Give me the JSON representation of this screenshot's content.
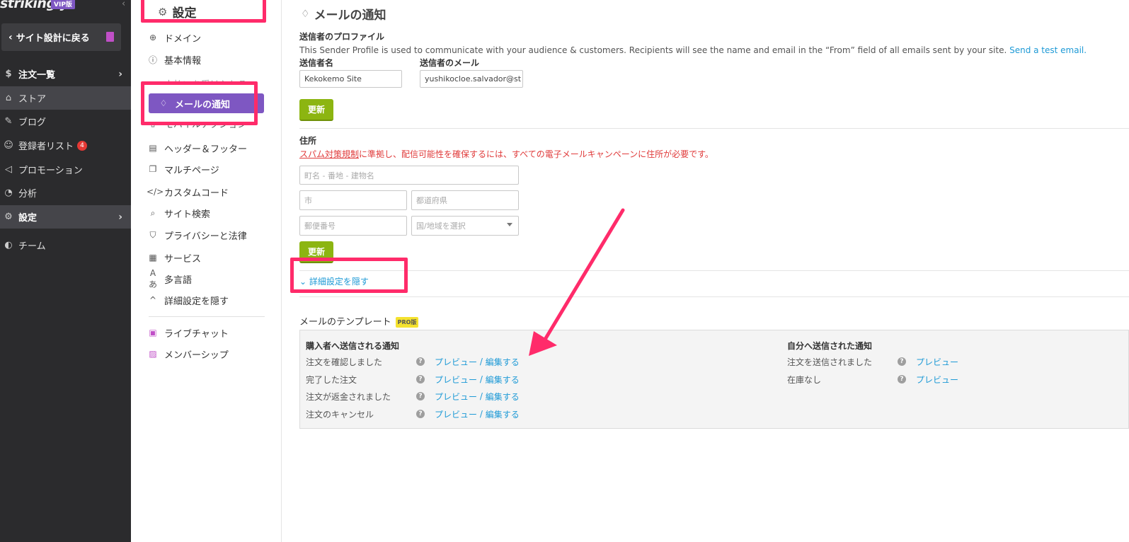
{
  "sidebar": {
    "logo": "strikingly",
    "plan_badge": "VIP版",
    "back_label": "サイト設計に戻る",
    "items": [
      {
        "label": "注文一覧",
        "icon": "dollar-circle-icon"
      },
      {
        "label": "ストア",
        "icon": "store-icon"
      },
      {
        "label": "ブログ",
        "icon": "pen-icon"
      },
      {
        "label": "登録者リスト",
        "icon": "users-icon",
        "badge": "4"
      },
      {
        "label": "プロモーション",
        "icon": "megaphone-icon"
      },
      {
        "label": "分析",
        "icon": "pie-chart-icon"
      },
      {
        "label": "設定",
        "icon": "gear-icon"
      },
      {
        "label": "チーム",
        "icon": "team-avatars-icon"
      }
    ]
  },
  "settings_menu": {
    "title": "設定",
    "items": [
      {
        "label": "ドメイン"
      },
      {
        "label": "基本情報"
      },
      {
        "label": "支払いを受け入れる"
      },
      {
        "label": "メールの通知"
      },
      {
        "label": "モバイルアクション"
      },
      {
        "label": "ヘッダー＆フッター"
      },
      {
        "label": "マルチページ"
      },
      {
        "label": "カスタムコード"
      },
      {
        "label": "サイト検索"
      },
      {
        "label": "プライバシーと法律"
      },
      {
        "label": "サービス"
      },
      {
        "label": "多言語"
      },
      {
        "label": "詳細設定を隠す"
      },
      {
        "label": "ライブチャット"
      },
      {
        "label": "メンバーシップ"
      }
    ]
  },
  "main": {
    "title": "メールの通知",
    "sender_profile": {
      "heading": "送信者のプロファイル",
      "description": "This Sender Profile is used to communicate with your audience & customers. Recipients will see the name and email in the “From” field of all emails sent by your site.",
      "test_link": "Send a test email.",
      "name_label": "送信者名",
      "name_value": "Kekokemo Site",
      "email_label": "送信者のメール",
      "email_value": "yushikocloe.salvador@st",
      "update_label": "更新"
    },
    "address": {
      "heading": "住所",
      "warning_link": "スパム対策規制",
      "warning_text": "に準拠し、配信可能性を確保するには、すべての電子メールキャンペーンに住所が必要です。",
      "street_placeholder": "町名 - 番地 - 建物名",
      "city_placeholder": "市",
      "prefecture_placeholder": "都道府県",
      "postal_placeholder": "郵便番号",
      "country_placeholder": "国/地域を選択",
      "update_label": "更新"
    },
    "advanced_toggle": "詳細設定を隠す",
    "templates": {
      "heading": "メールのテンプレート",
      "pro_badge": "PRO版",
      "buyer_heading": "購入者へ送信される通知",
      "buyer_rows": [
        {
          "name": "注文を確認しました",
          "preview": "プレビュー",
          "sep": " / ",
          "edit": "編集する"
        },
        {
          "name": "完了した注文",
          "preview": "プレビュー",
          "sep": " / ",
          "edit": "編集する"
        },
        {
          "name": "注文が返金されました",
          "preview": "プレビュー",
          "sep": " / ",
          "edit": "編集する"
        },
        {
          "name": "注文のキャンセル",
          "preview": "プレビュー",
          "sep": " / ",
          "edit": "編集する"
        }
      ],
      "self_heading": "自分へ送信された通知",
      "self_rows": [
        {
          "name": "注文を送信されました",
          "preview": "プレビュー"
        },
        {
          "name": "在庫なし",
          "preview": "プレビュー"
        }
      ]
    }
  },
  "colors": {
    "sidebar_bg": "#2b2b2d",
    "accent_purple": "#7e57c2",
    "button_green": "#8cb511",
    "link_blue": "#1e9ad6",
    "annotation_pink": "#ff2b6a",
    "warning_red": "#e03b3b"
  }
}
